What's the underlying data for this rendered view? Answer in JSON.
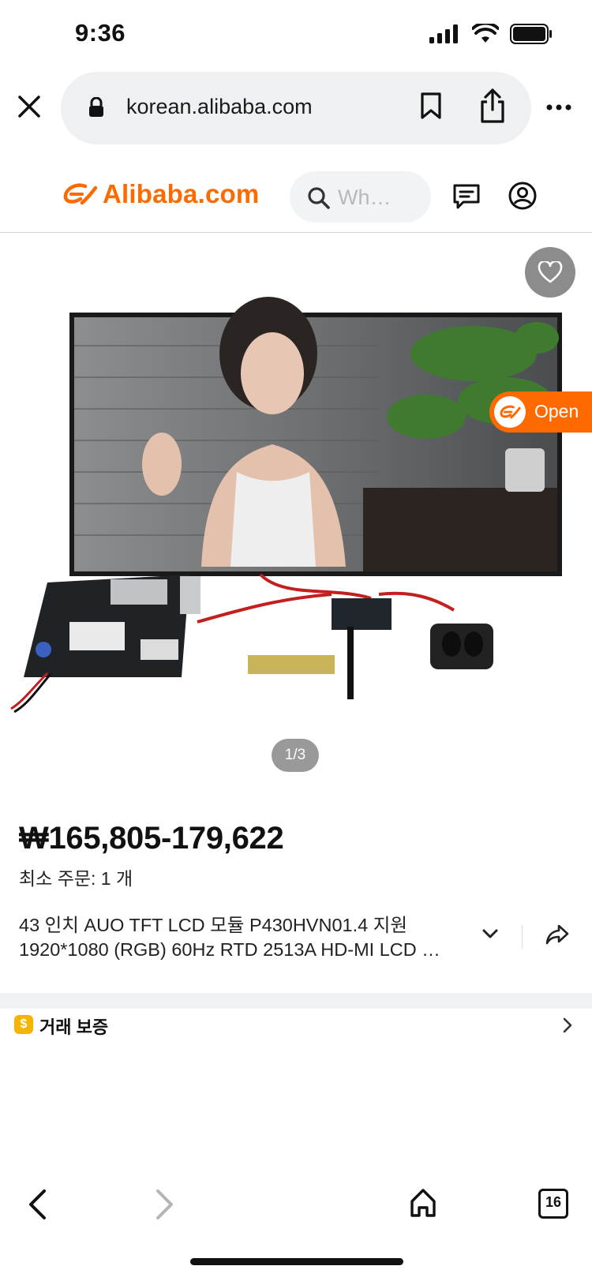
{
  "status": {
    "time": "9:36"
  },
  "browser": {
    "url": "korean.alibaba.com",
    "tab_count": "16"
  },
  "header": {
    "logo_text": "Alibaba.com",
    "search_placeholder": "Wh…"
  },
  "hero": {
    "pager": "1/3",
    "open_label": "Open"
  },
  "product": {
    "price": "₩165,805-179,622",
    "moq": "최소 주문: 1 개",
    "title_line1": "43 인치 AUO TFT LCD 모듈 P430HVN01.4 지원",
    "title_line2": "1920*1080 (RGB) 60Hz RTD 2513A HD-MI LCD …"
  },
  "trade": {
    "label": "거래 보증",
    "badge": "$"
  },
  "colors": {
    "brand": "#ff6a00",
    "badge": "#f5b400"
  }
}
